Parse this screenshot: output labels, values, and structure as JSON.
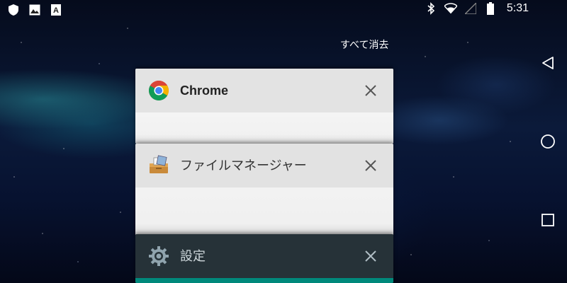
{
  "status_bar": {
    "left_icons": [
      "shield-icon",
      "image-icon",
      "font-a-icon"
    ],
    "right_icons": [
      "bluetooth-icon",
      "wifi-icon",
      "signal-icon",
      "battery-icon"
    ],
    "time": "5:31"
  },
  "recents": {
    "clear_all_label": "すべて消去",
    "cards": [
      {
        "app": "Chrome",
        "icon": "chrome-icon",
        "close_icon": "close-icon"
      },
      {
        "app": "ファイルマネージャー",
        "icon": "file-manager-icon",
        "close_icon": "close-icon"
      },
      {
        "app": "設定",
        "icon": "settings-gear-icon",
        "close_icon": "close-icon"
      }
    ]
  },
  "nav_bar": {
    "buttons": [
      "back-icon",
      "home-icon",
      "recents-icon"
    ]
  },
  "colors": {
    "settings_header": "#263238",
    "settings_accent": "#00897b",
    "card_light": "#e3e3e3"
  }
}
